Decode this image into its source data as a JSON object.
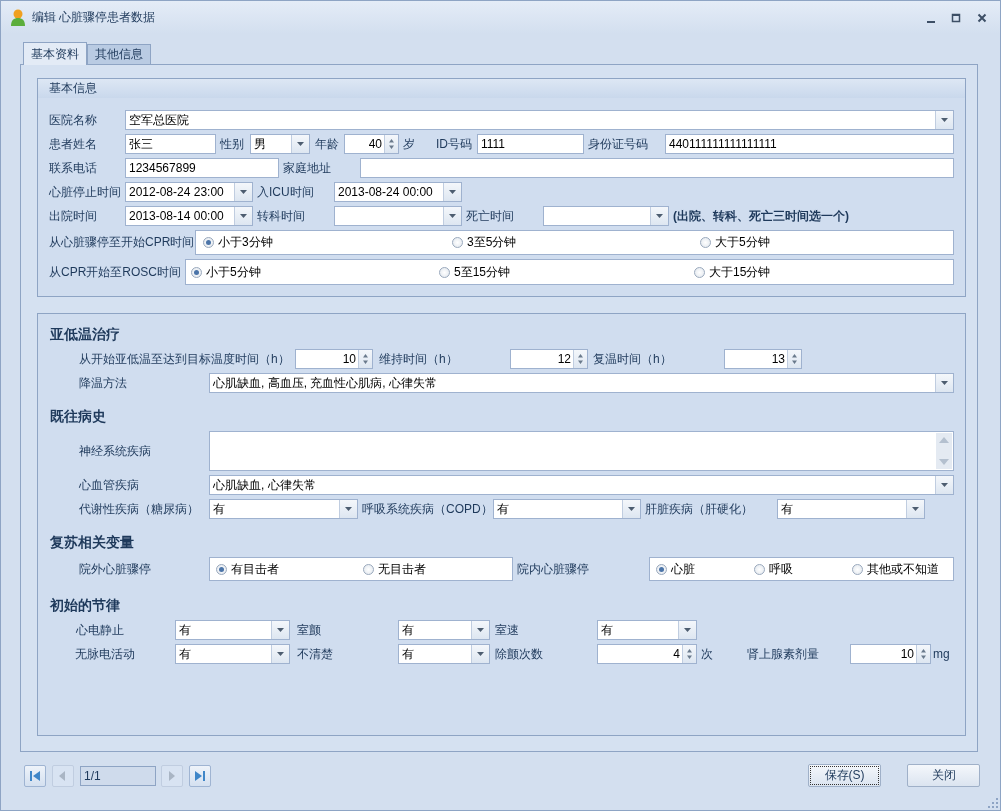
{
  "window": {
    "title": "编辑 心脏骤停患者数据"
  },
  "tabs": [
    {
      "label": "基本资料",
      "selected": true
    },
    {
      "label": "其他信息",
      "selected": false
    }
  ],
  "basic_info": {
    "title": "基本信息",
    "rows": [
      {
        "items": [
          {
            "kind": "label",
            "text": "医院名称"
          },
          {
            "kind": "combo",
            "value": "空军总医院"
          }
        ]
      },
      {
        "items": [
          {
            "kind": "label",
            "text": "患者姓名"
          },
          {
            "kind": "text",
            "value": "张三"
          },
          {
            "kind": "label",
            "text": "性别"
          },
          {
            "kind": "combo",
            "value": "男"
          },
          {
            "kind": "label",
            "text": "年龄"
          },
          {
            "kind": "spin",
            "value": "40"
          },
          {
            "kind": "label",
            "text": "岁"
          },
          {
            "kind": "label",
            "text": "ID号码"
          },
          {
            "kind": "text",
            "value": "1111"
          },
          {
            "kind": "label",
            "text": "身份证号码"
          },
          {
            "kind": "text",
            "value": "440111111111111111"
          }
        ]
      },
      {
        "items": [
          {
            "kind": "label",
            "text": "联系电话"
          },
          {
            "kind": "text",
            "value": "1234567899"
          },
          {
            "kind": "label",
            "text": "家庭地址"
          },
          {
            "kind": "text"
          }
        ]
      },
      {
        "items": [
          {
            "kind": "label",
            "text": "心脏停止时间"
          },
          {
            "kind": "combo",
            "value": "2012-08-24 23:00"
          },
          {
            "kind": "label",
            "text": "入ICU时间"
          },
          {
            "kind": "combo",
            "value": "2013-08-24 00:00"
          }
        ]
      },
      {
        "items": [
          {
            "kind": "label",
            "text": "出院时间"
          },
          {
            "kind": "combo",
            "value": "2013-08-14 00:00"
          },
          {
            "kind": "label",
            "text": "转科时间"
          },
          {
            "kind": "combo"
          },
          {
            "kind": "label",
            "text": "死亡时间"
          },
          {
            "kind": "combo"
          },
          {
            "kind": "note",
            "text": "(出院、转科、死亡三时间选一个)"
          }
        ]
      },
      {
        "items": [
          {
            "kind": "label",
            "text": "从心脏骤停至开始CPR时间"
          },
          {
            "kind": "radios",
            "options": [
              {
                "label": "小于3分钟",
                "selected": true
              },
              {
                "label": "3至5分钟",
                "selected": false
              },
              {
                "label": "大于5分钟",
                "selected": false
              }
            ]
          }
        ]
      },
      {
        "items": [
          {
            "kind": "label",
            "text": "从CPR开始至ROSC时间"
          },
          {
            "kind": "radios",
            "options": [
              {
                "label": "小于5分钟",
                "selected": true
              },
              {
                "label": "5至15分钟",
                "selected": false
              },
              {
                "label": "大于15分钟",
                "selected": false
              }
            ]
          }
        ]
      }
    ]
  },
  "sections": [
    {
      "title": "亚低温治疗",
      "rows": [
        {
          "items": [
            {
              "kind": "label",
              "text": "从开始亚低温至达到目标温度时间（h）"
            },
            {
              "kind": "spin",
              "value": "10"
            },
            {
              "kind": "label",
              "text": "维持时间（h）"
            },
            {
              "kind": "spin",
              "value": "12"
            },
            {
              "kind": "label",
              "text": "复温时间（h）"
            },
            {
              "kind": "spin",
              "value": "13"
            }
          ]
        },
        {
          "items": [
            {
              "kind": "label",
              "text": "降温方法"
            },
            {
              "kind": "combo",
              "value": "心肌缺血, 高血压, 充血性心肌病, 心律失常"
            }
          ]
        }
      ]
    },
    {
      "title": "既往病史",
      "rows": [
        {
          "items": [
            {
              "kind": "label",
              "text": "神经系统疾病"
            },
            {
              "kind": "memo"
            }
          ]
        },
        {
          "items": [
            {
              "kind": "label",
              "text": "心血管疾病"
            },
            {
              "kind": "combo",
              "value": "心肌缺血, 心律失常"
            }
          ]
        },
        {
          "items": [
            {
              "kind": "label",
              "text": "代谢性疾病（糖尿病）"
            },
            {
              "kind": "combo",
              "value": "有"
            },
            {
              "kind": "label",
              "text": "呼吸系统疾病（COPD）"
            },
            {
              "kind": "combo",
              "value": "有"
            },
            {
              "kind": "label",
              "text": "肝脏疾病（肝硬化）"
            },
            {
              "kind": "combo",
              "value": "有"
            }
          ]
        }
      ]
    },
    {
      "title": "复苏相关变量",
      "rows": [
        {
          "items": [
            {
              "kind": "label",
              "text": "院外心脏骤停"
            },
            {
              "kind": "radios",
              "options": [
                {
                  "label": "有目击者",
                  "selected": true
                },
                {
                  "label": "无目击者",
                  "selected": false
                }
              ]
            },
            {
              "kind": "label",
              "text": "院内心脏骤停"
            },
            {
              "kind": "radios",
              "options": [
                {
                  "label": "心脏",
                  "selected": true
                },
                {
                  "label": "呼吸",
                  "selected": false
                },
                {
                  "label": "其他或不知道",
                  "selected": false
                }
              ]
            }
          ]
        }
      ]
    },
    {
      "title": "初始的节律",
      "rows": [
        {
          "items": [
            {
              "kind": "label",
              "text": "心电静止"
            },
            {
              "kind": "combo",
              "value": "有"
            },
            {
              "kind": "label",
              "text": "室颤"
            },
            {
              "kind": "combo",
              "value": "有"
            },
            {
              "kind": "label",
              "text": "室速"
            },
            {
              "kind": "combo",
              "value": "有"
            }
          ]
        },
        {
          "items": [
            {
              "kind": "label",
              "text": "无脉电活动"
            },
            {
              "kind": "combo",
              "value": "有"
            },
            {
              "kind": "label",
              "text": "不清楚"
            },
            {
              "kind": "combo",
              "value": "有"
            },
            {
              "kind": "label",
              "text": "除颤次数"
            },
            {
              "kind": "spin",
              "value": "4"
            },
            {
              "kind": "label",
              "text": "次"
            },
            {
              "kind": "label",
              "text": "肾上腺素剂量"
            },
            {
              "kind": "spin",
              "value": "10"
            },
            {
              "kind": "label",
              "text": "mg"
            }
          ]
        }
      ]
    }
  ],
  "pager": {
    "position": "1/1",
    "nav_buttons": [
      {
        "kind": "first",
        "disabled": false
      },
      {
        "kind": "prev",
        "disabled": true
      },
      {
        "kind": "next",
        "disabled": true
      },
      {
        "kind": "last",
        "disabled": false
      }
    ]
  },
  "buttons": [
    {
      "label": "保存(S)",
      "focused": true
    },
    {
      "label": "关闭",
      "focused": false
    }
  ]
}
